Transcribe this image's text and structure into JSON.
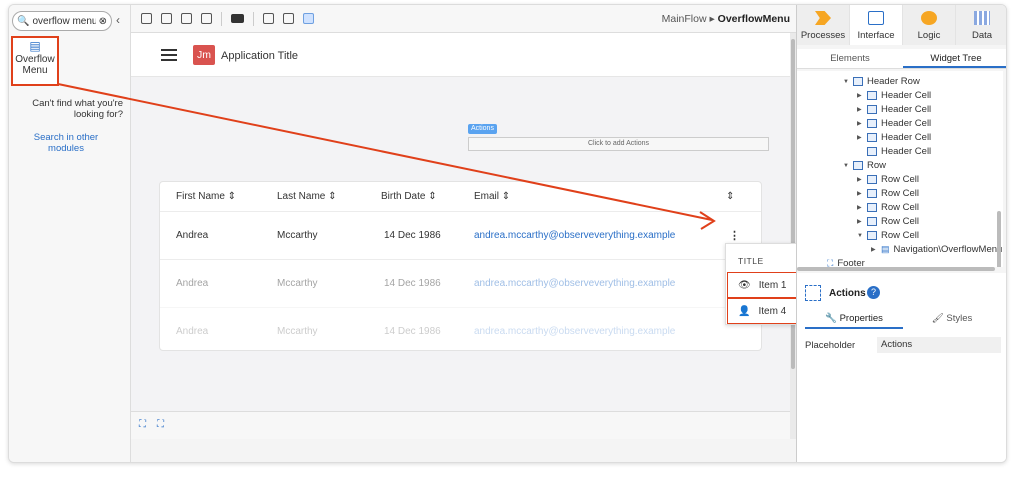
{
  "search": {
    "value": "overflow menu"
  },
  "toolbox": {
    "widget_label": "Overflow Menu",
    "cant_find": "Can't find what you're looking for?",
    "search_other": "Search in other modules"
  },
  "breadcrumb": {
    "flow": "MainFlow",
    "screen": "OverflowMenu"
  },
  "canvas": {
    "avatar": "Jm",
    "app_title": "Application Title",
    "actions_tag": "Actions",
    "actions_placeholder": "Click to add Actions",
    "columns": [
      "First Name ⇕",
      "Last Name ⇕",
      "Birth Date ⇕",
      "Email ⇕",
      "⇕"
    ],
    "rows": [
      {
        "first": "Andrea",
        "last": "Mccarthy",
        "birth": "14 Dec 1986",
        "email": "andrea.mccarthy@observeverything.example",
        "menu": "⋮"
      },
      {
        "first": "Andrea",
        "last": "Mccarthy",
        "birth": "14 Dec 1986",
        "email": "andrea.mccarthy@observeverything.example"
      },
      {
        "first": "Andrea",
        "last": "Mccarthy",
        "birth": "14 Dec 1986",
        "email": "andrea.mccarthy@observeverything.example"
      }
    ]
  },
  "popup": {
    "title": "TITLE",
    "item1": "Item 1",
    "item2": "Item 4"
  },
  "right": {
    "tabs": [
      "Processes",
      "Interface",
      "Logic",
      "Data"
    ],
    "subtabs": [
      "Elements",
      "Widget Tree"
    ],
    "tree": [
      "Header Row",
      "Header Cell",
      "Header Cell",
      "Header Cell",
      "Header Cell",
      "Header Cell",
      "Row",
      "Row Cell",
      "Row Cell",
      "Row Cell",
      "Row Cell",
      "Row Cell",
      "Navigation\\OverflowMenu",
      "Footer"
    ],
    "selected": "Actions",
    "prop_tabs": [
      "Properties",
      "Styles"
    ],
    "prop_label": "Placeholder",
    "prop_value": "Actions"
  },
  "colors": {
    "accent": "#2a6fc7",
    "highlight": "#e0401a",
    "avatar": "#d9534f"
  }
}
